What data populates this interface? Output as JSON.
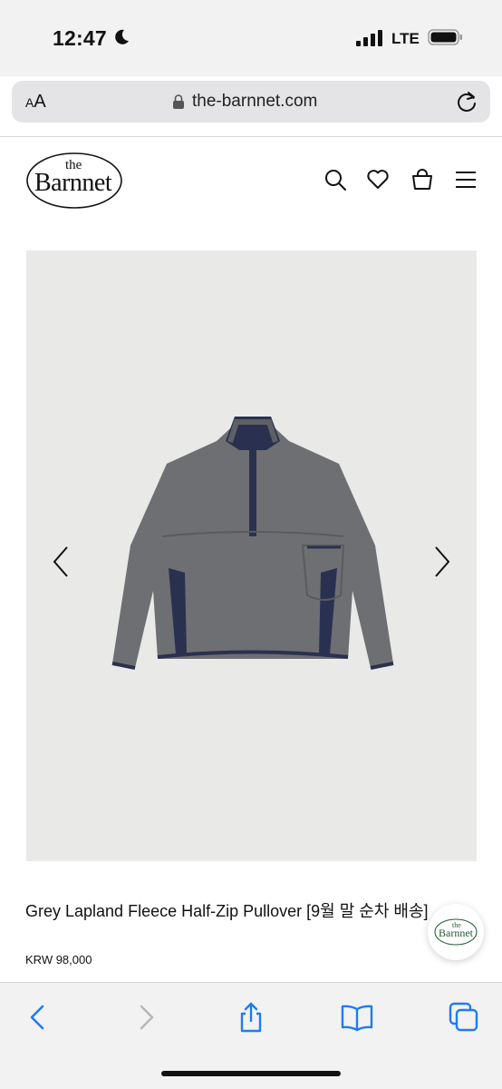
{
  "status_bar": {
    "time": "12:47",
    "carrier": "LTE",
    "icons": [
      "moon-icon",
      "signal-icon",
      "battery-icon"
    ]
  },
  "browser": {
    "text_size_label_small": "A",
    "text_size_label_large": "A",
    "url": "the-barnnet.com",
    "icons": [
      "lock-icon",
      "reload-icon"
    ]
  },
  "header": {
    "logo_the": "the",
    "logo_name": "Barnnet",
    "icons": [
      "search-icon",
      "heart-icon",
      "bag-icon",
      "menu-icon"
    ]
  },
  "product": {
    "title": "Grey Lapland Fleece Half-Zip Pullover [9월 말 순차 배송]",
    "price": "KRW 98,000",
    "image_colors": {
      "background": "#e9e9e7",
      "fleece": "#6e6f72",
      "trim": "#2a3150"
    }
  },
  "fab": {
    "logo_the": "the",
    "logo_name": "Barnnet"
  },
  "toolbar": {
    "icons": [
      "back-icon",
      "forward-icon",
      "share-icon",
      "bookmarks-icon",
      "tabs-icon"
    ]
  },
  "colors": {
    "ios_blue": "#1e7cf2",
    "disabled": "#b8b8bc",
    "brand_green": "#1f5b2f"
  }
}
